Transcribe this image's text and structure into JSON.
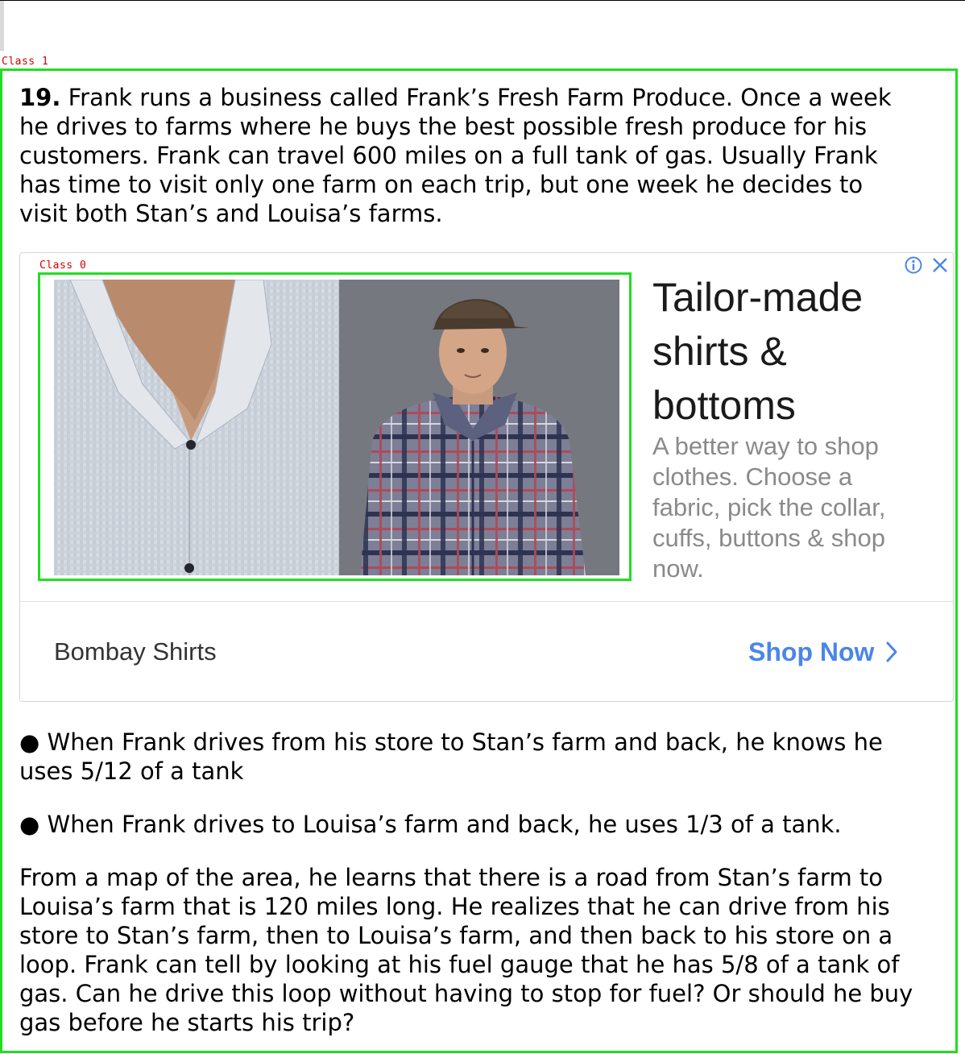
{
  "annotations": {
    "outer_label": "Class 1",
    "inner_label": "Class 0"
  },
  "question": {
    "number": "19.",
    "intro_lines": [
      " Frank runs a business called Frank’s Fresh Farm Produce. Once a week",
      "he drives to farms where he buys the best possible fresh produce for his",
      "customers. Frank can travel 600 miles on a full tank of gas. Usually Frank",
      "has time to visit only one farm on each trip, but one week he decides to",
      "visit both Stan’s and Louisa’s farms."
    ],
    "bullet1_lines": [
      "● When Frank drives from his store to Stan’s farm and back, he knows he",
      "uses 5/12 of a tank"
    ],
    "bullet2": "● When Frank drives to Louisa’s farm and back, he uses 1/3 of a tank.",
    "closing_lines": [
      "From a map of the area, he learns that there is a road from Stan’s farm to",
      "Louisa’s farm that is 120 miles long. He realizes that he can drive from his",
      "store to Stan’s farm, then to Louisa’s farm, and then back to his store on a",
      "loop. Frank can tell by looking at his fuel gauge that he has 5/8 of a tank of",
      "gas. Can he drive this loop without having to stop for fuel? Or should he buy",
      "gas before he starts his trip?"
    ]
  },
  "ad": {
    "headline_lines": [
      "Tailor-made",
      "shirts &",
      "bottoms"
    ],
    "description_lines": [
      "A better way to shop",
      "clothes. Choose a",
      "fabric, pick the collar,",
      "cuffs, buttons & shop",
      "now."
    ],
    "brand": "Bombay Shirts",
    "cta": "Shop Now",
    "icons": {
      "info": "info-icon",
      "close": "close-icon",
      "cta_arrow": "chevron-right-icon"
    },
    "colors": {
      "cta": "#4a86e8",
      "description": "#8a8a8a"
    }
  },
  "colors": {
    "annotation_box": "#22dd22",
    "annotation_label": "#d40000"
  }
}
